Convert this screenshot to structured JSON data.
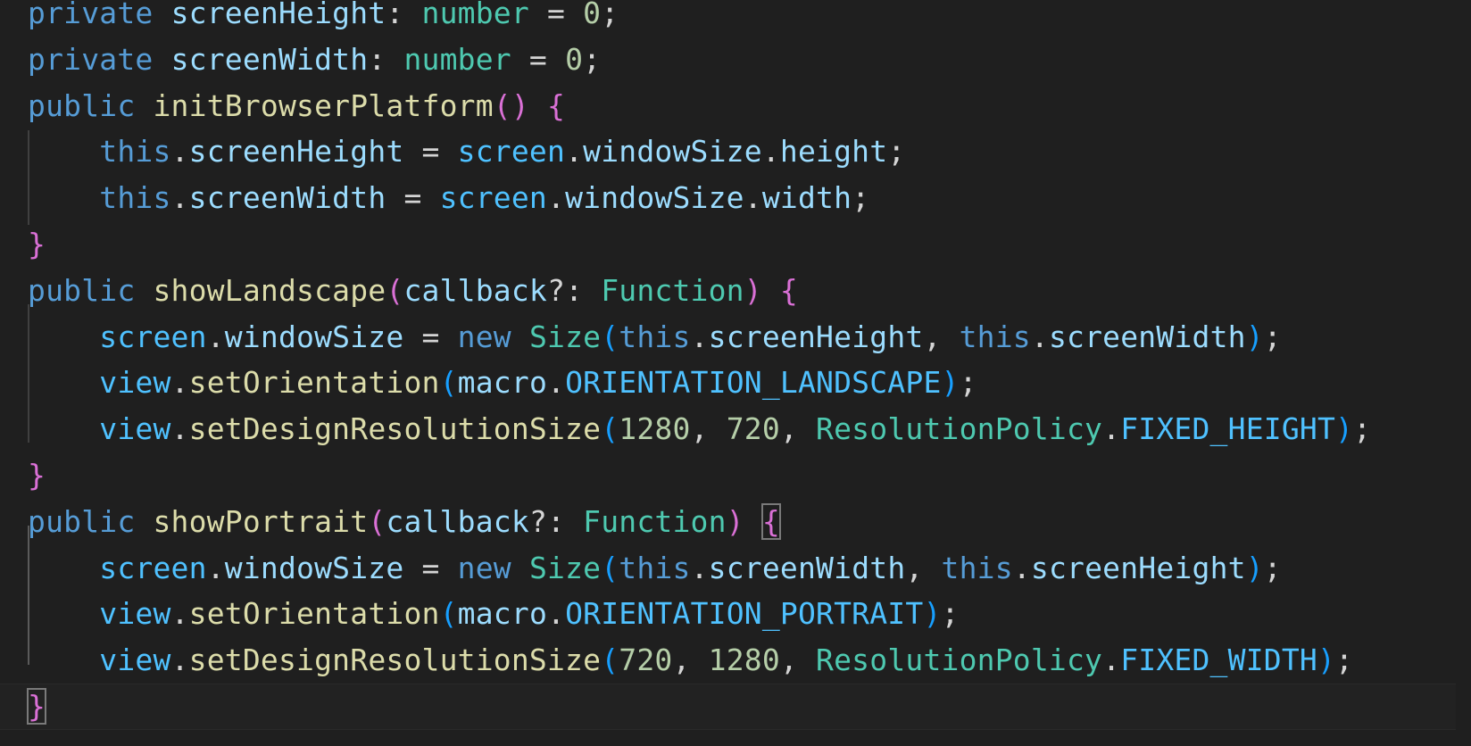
{
  "theme": {
    "background": "#1f1f1f",
    "keyword": "#569cd6",
    "variable": "#9cdcfe",
    "variable_bright": "#4fc1ff",
    "function": "#dcdcaa",
    "type": "#4ec9b0",
    "number": "#b5cea8",
    "punct": "#d4d4d4",
    "bracket_gold": "#ffd700",
    "bracket_purple": "#da70d6",
    "bracket_blue": "#179fff",
    "param": "#9cdcfe"
  },
  "code_lines": [
    [
      {
        "t": "private",
        "c": "keyword"
      },
      {
        "t": " ",
        "c": "punct"
      },
      {
        "t": "screenHeight",
        "c": "variable"
      },
      {
        "t": ": ",
        "c": "punct"
      },
      {
        "t": "number",
        "c": "type"
      },
      {
        "t": " = ",
        "c": "punct"
      },
      {
        "t": "0",
        "c": "number"
      },
      {
        "t": ";",
        "c": "punct"
      }
    ],
    [
      {
        "t": "private",
        "c": "keyword"
      },
      {
        "t": " ",
        "c": "punct"
      },
      {
        "t": "screenWidth",
        "c": "variable"
      },
      {
        "t": ": ",
        "c": "punct"
      },
      {
        "t": "number",
        "c": "type"
      },
      {
        "t": " = ",
        "c": "punct"
      },
      {
        "t": "0",
        "c": "number"
      },
      {
        "t": ";",
        "c": "punct"
      }
    ],
    [
      {
        "t": "public",
        "c": "keyword"
      },
      {
        "t": " ",
        "c": "punct"
      },
      {
        "t": "initBrowserPlatform",
        "c": "function"
      },
      {
        "t": "()",
        "c": "bracket_purple"
      },
      {
        "t": " ",
        "c": "punct"
      },
      {
        "t": "{",
        "c": "bracket_purple"
      }
    ],
    [
      {
        "t": "    ",
        "c": "punct"
      },
      {
        "t": "this",
        "c": "keyword"
      },
      {
        "t": ".",
        "c": "punct"
      },
      {
        "t": "screenHeight",
        "c": "variable"
      },
      {
        "t": " = ",
        "c": "punct"
      },
      {
        "t": "screen",
        "c": "variable_bright"
      },
      {
        "t": ".",
        "c": "punct"
      },
      {
        "t": "windowSize",
        "c": "variable"
      },
      {
        "t": ".",
        "c": "punct"
      },
      {
        "t": "height",
        "c": "variable"
      },
      {
        "t": ";",
        "c": "punct"
      }
    ],
    [
      {
        "t": "    ",
        "c": "punct"
      },
      {
        "t": "this",
        "c": "keyword"
      },
      {
        "t": ".",
        "c": "punct"
      },
      {
        "t": "screenWidth",
        "c": "variable"
      },
      {
        "t": " = ",
        "c": "punct"
      },
      {
        "t": "screen",
        "c": "variable_bright"
      },
      {
        "t": ".",
        "c": "punct"
      },
      {
        "t": "windowSize",
        "c": "variable"
      },
      {
        "t": ".",
        "c": "punct"
      },
      {
        "t": "width",
        "c": "variable"
      },
      {
        "t": ";",
        "c": "punct"
      }
    ],
    [
      {
        "t": "}",
        "c": "bracket_purple"
      }
    ],
    [
      {
        "t": "public",
        "c": "keyword"
      },
      {
        "t": " ",
        "c": "punct"
      },
      {
        "t": "showLandscape",
        "c": "function"
      },
      {
        "t": "(",
        "c": "bracket_purple"
      },
      {
        "t": "callback",
        "c": "param"
      },
      {
        "t": "?: ",
        "c": "punct"
      },
      {
        "t": "Function",
        "c": "type"
      },
      {
        "t": ")",
        "c": "bracket_purple"
      },
      {
        "t": " ",
        "c": "punct"
      },
      {
        "t": "{",
        "c": "bracket_purple"
      }
    ],
    [
      {
        "t": "    ",
        "c": "punct"
      },
      {
        "t": "screen",
        "c": "variable_bright"
      },
      {
        "t": ".",
        "c": "punct"
      },
      {
        "t": "windowSize",
        "c": "variable"
      },
      {
        "t": " = ",
        "c": "punct"
      },
      {
        "t": "new",
        "c": "keyword"
      },
      {
        "t": " ",
        "c": "punct"
      },
      {
        "t": "Size",
        "c": "type"
      },
      {
        "t": "(",
        "c": "bracket_blue"
      },
      {
        "t": "this",
        "c": "keyword"
      },
      {
        "t": ".",
        "c": "punct"
      },
      {
        "t": "screenHeight",
        "c": "variable"
      },
      {
        "t": ", ",
        "c": "punct"
      },
      {
        "t": "this",
        "c": "keyword"
      },
      {
        "t": ".",
        "c": "punct"
      },
      {
        "t": "screenWidth",
        "c": "variable"
      },
      {
        "t": ")",
        "c": "bracket_blue"
      },
      {
        "t": ";",
        "c": "punct"
      }
    ],
    [
      {
        "t": "    ",
        "c": "punct"
      },
      {
        "t": "view",
        "c": "variable_bright"
      },
      {
        "t": ".",
        "c": "punct"
      },
      {
        "t": "setOrientation",
        "c": "function"
      },
      {
        "t": "(",
        "c": "bracket_blue"
      },
      {
        "t": "macro",
        "c": "variable"
      },
      {
        "t": ".",
        "c": "punct"
      },
      {
        "t": "ORIENTATION_LANDSCAPE",
        "c": "variable_bright"
      },
      {
        "t": ")",
        "c": "bracket_blue"
      },
      {
        "t": ";",
        "c": "punct"
      }
    ],
    [
      {
        "t": "    ",
        "c": "punct"
      },
      {
        "t": "view",
        "c": "variable_bright"
      },
      {
        "t": ".",
        "c": "punct"
      },
      {
        "t": "setDesignResolutionSize",
        "c": "function"
      },
      {
        "t": "(",
        "c": "bracket_blue"
      },
      {
        "t": "1280",
        "c": "number"
      },
      {
        "t": ", ",
        "c": "punct"
      },
      {
        "t": "720",
        "c": "number"
      },
      {
        "t": ", ",
        "c": "punct"
      },
      {
        "t": "ResolutionPolicy",
        "c": "type"
      },
      {
        "t": ".",
        "c": "punct"
      },
      {
        "t": "FIXED_HEIGHT",
        "c": "variable_bright"
      },
      {
        "t": ")",
        "c": "bracket_blue"
      },
      {
        "t": ";",
        "c": "punct"
      }
    ],
    [
      {
        "t": "}",
        "c": "bracket_purple"
      }
    ],
    [
      {
        "t": "public",
        "c": "keyword"
      },
      {
        "t": " ",
        "c": "punct"
      },
      {
        "t": "showPortrait",
        "c": "function"
      },
      {
        "t": "(",
        "c": "bracket_purple"
      },
      {
        "t": "callback",
        "c": "param"
      },
      {
        "t": "?: ",
        "c": "punct"
      },
      {
        "t": "Function",
        "c": "type"
      },
      {
        "t": ")",
        "c": "bracket_purple"
      },
      {
        "t": " ",
        "c": "punct"
      },
      {
        "t": "{",
        "c": "bracket_purple",
        "box": true
      }
    ],
    [
      {
        "t": "    ",
        "c": "punct"
      },
      {
        "t": "screen",
        "c": "variable_bright"
      },
      {
        "t": ".",
        "c": "punct"
      },
      {
        "t": "windowSize",
        "c": "variable"
      },
      {
        "t": " = ",
        "c": "punct"
      },
      {
        "t": "new",
        "c": "keyword"
      },
      {
        "t": " ",
        "c": "punct"
      },
      {
        "t": "Size",
        "c": "type"
      },
      {
        "t": "(",
        "c": "bracket_blue"
      },
      {
        "t": "this",
        "c": "keyword"
      },
      {
        "t": ".",
        "c": "punct"
      },
      {
        "t": "screenWidth",
        "c": "variable"
      },
      {
        "t": ", ",
        "c": "punct"
      },
      {
        "t": "this",
        "c": "keyword"
      },
      {
        "t": ".",
        "c": "punct"
      },
      {
        "t": "screenHeight",
        "c": "variable"
      },
      {
        "t": ")",
        "c": "bracket_blue"
      },
      {
        "t": ";",
        "c": "punct"
      }
    ],
    [
      {
        "t": "    ",
        "c": "punct"
      },
      {
        "t": "view",
        "c": "variable_bright"
      },
      {
        "t": ".",
        "c": "punct"
      },
      {
        "t": "setOrientation",
        "c": "function"
      },
      {
        "t": "(",
        "c": "bracket_blue"
      },
      {
        "t": "macro",
        "c": "variable"
      },
      {
        "t": ".",
        "c": "punct"
      },
      {
        "t": "ORIENTATION_PORTRAIT",
        "c": "variable_bright"
      },
      {
        "t": ")",
        "c": "bracket_blue"
      },
      {
        "t": ";",
        "c": "punct"
      }
    ],
    [
      {
        "t": "    ",
        "c": "punct"
      },
      {
        "t": "view",
        "c": "variable_bright"
      },
      {
        "t": ".",
        "c": "punct"
      },
      {
        "t": "setDesignResolutionSize",
        "c": "function"
      },
      {
        "t": "(",
        "c": "bracket_blue"
      },
      {
        "t": "720",
        "c": "number"
      },
      {
        "t": ", ",
        "c": "punct"
      },
      {
        "t": "1280",
        "c": "number"
      },
      {
        "t": ", ",
        "c": "punct"
      },
      {
        "t": "ResolutionPolicy",
        "c": "type"
      },
      {
        "t": ".",
        "c": "punct"
      },
      {
        "t": "FIXED_WIDTH",
        "c": "variable_bright"
      },
      {
        "t": ")",
        "c": "bracket_blue"
      },
      {
        "t": ";",
        "c": "punct"
      }
    ],
    [
      {
        "t": "}",
        "c": "bracket_purple",
        "box": true
      }
    ]
  ]
}
